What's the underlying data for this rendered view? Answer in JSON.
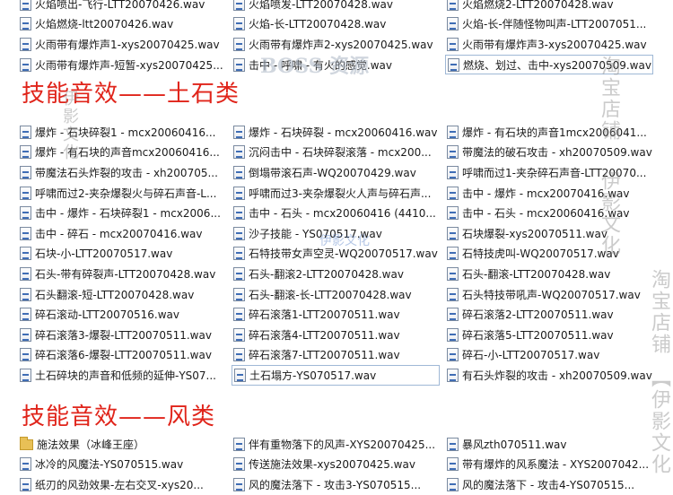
{
  "sections": {
    "top_rows": [
      [
        "火焰喷出-飞行-LTT20070426.wav",
        "火焰喷发-LTT20070428.wav",
        "火焰燃烧2-LTT20070428.wav"
      ],
      [
        "火焰燃烧-ltt20070426.wav",
        "火焰-长-LTT20070428.wav",
        "火焰-长-伴随怪物叫声-LTT2007051..."
      ],
      [
        "火雨带有爆炸声1-xys20070425.wav",
        "火雨带有爆炸声2-xys20070425.wav",
        "火雨带有爆炸声3-xys20070425.wav"
      ],
      [
        "火雨带有爆炸声-短暂-xys20070425...",
        "击中 - 呼啸 - 有火的感觉.wav",
        "燃烧、划过、击中-xys20070509.wav"
      ]
    ],
    "earth": {
      "title": "技能音效——土石类",
      "rows": [
        [
          "爆炸 - 石块碎裂1 - mcx20060416...",
          "爆炸 - 石块碎裂 - mcx20060416.wav",
          "爆炸 - 有石块的声音1mcx2006041..."
        ],
        [
          "爆炸 - 有石块的声音mcx20060416...",
          "沉闷击中 - 石块碎裂滚落 - mcx200...",
          "带魔法的破石攻击 - xh20070509.wav"
        ],
        [
          "带魔法石头炸裂的攻击 - xh200705...",
          "倒塌带滚石声-WQ20070429.wav",
          "呼啸而过1-夹杂碎石声音-LTT20070..."
        ],
        [
          "呼啸而过2-夹杂爆裂火与碎石声音-L...",
          "呼啸而过3-夹杂爆裂火人声与碎石声...",
          "击中 - 爆炸 - mcx20070416.wav"
        ],
        [
          "击中 - 爆炸 - 石块碎裂1 - mcx2006...",
          "击中 - 石头 - mcx20060416 (4410...",
          "击中 - 石头 - mcx20060416.wav"
        ],
        [
          "击中 - 碎石 - mcx20070416.wav",
          "沙子技能 - YS070517.wav",
          "石块爆裂-xys20070511.wav"
        ],
        [
          "石块-小-LTT20070517.wav",
          "石特技带女声空灵-WQ20070517.wav",
          "石特技虎叫-WQ20070517.wav"
        ],
        [
          "石头-带有碎裂声-LTT20070428.wav",
          "石头-翻滚2-LTT20070428.wav",
          "石头-翻滚-LTT20070428.wav"
        ],
        [
          "石头翻滚-短-LTT20070428.wav",
          "石头-翻滚-长-LTT20070428.wav",
          "石头特技带吼声-WQ20070517.wav"
        ],
        [
          "碎石滚动-LTT20070516.wav",
          "碎石滚落1-LTT20070511.wav",
          "碎石滚落2-LTT20070511.wav"
        ],
        [
          "碎石滚落3-爆裂-LTT20070511.wav",
          "碎石滚落4-LTT20070511.wav",
          "碎石滚落5-LTT20070511.wav"
        ],
        [
          "碎石滚落6-爆裂-LTT20070511.wav",
          "碎石滚落7-LTT20070511.wav",
          "碎石-小-LTT20070517.wav"
        ],
        [
          "土石碎块的声音和低频的延伸-YS07...",
          "土石塌方-YS070517.wav",
          "有石头炸裂的攻击 - xh20070509.wav"
        ]
      ]
    },
    "wind": {
      "title": "技能音效——风类",
      "rows": [
        [
          "施法效果（冰峰王座）",
          "伴有重物落下的风声-XYS20070425...",
          "暴风zth070511.wav"
        ],
        [
          "冰冷的风魔法-YS070515.wav",
          "传送施法效果-xys20070425.wav",
          "带有爆炸的风系魔法 - XYS2007042..."
        ],
        [
          "纸刃的风劲效果-左右交叉-xys20...",
          "风的魔法落下 - 攻击3-YS070515...",
          "风的魔法落下 - 攻击4-YS070515..."
        ]
      ]
    }
  },
  "watermarks": {
    "boss": "BOSS 资源",
    "taobao1": "淘宝店铺",
    "yiying1": "伊影文化",
    "taobao2": "淘宝店铺",
    "yiying2": "【伊影文化",
    "center": "伊影文化",
    "left": "伊影文化"
  }
}
